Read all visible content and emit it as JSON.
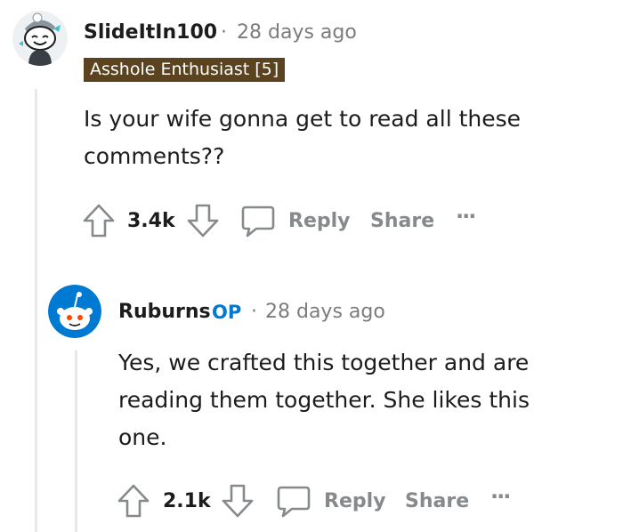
{
  "comment1": {
    "username": "SlideItIn100",
    "separator": "·",
    "time": "28 days ago",
    "flair": "Asshole Enthusiast [5]",
    "body_line1": "Is your wife gonna get to read all these",
    "body_line2": "comments??",
    "votes": "3.4k",
    "reply_label": "Reply",
    "share_label": "Share",
    "more_label": "···"
  },
  "comment2": {
    "username": "Ruburns",
    "op_label": "OP",
    "separator": "·",
    "time": "28 days ago",
    "body_line1": "Yes, we crafted this together and are",
    "body_line2": "reading them together. She likes this",
    "body_line3": "one.",
    "votes": "2.1k",
    "reply_label": "Reply",
    "share_label": "Share",
    "more_label": "···"
  },
  "colors": {
    "flair_bg": "#5b4320",
    "op_blue": "#0079d3",
    "muted": "#878a8c",
    "thread_line": "#e8e8e8"
  }
}
